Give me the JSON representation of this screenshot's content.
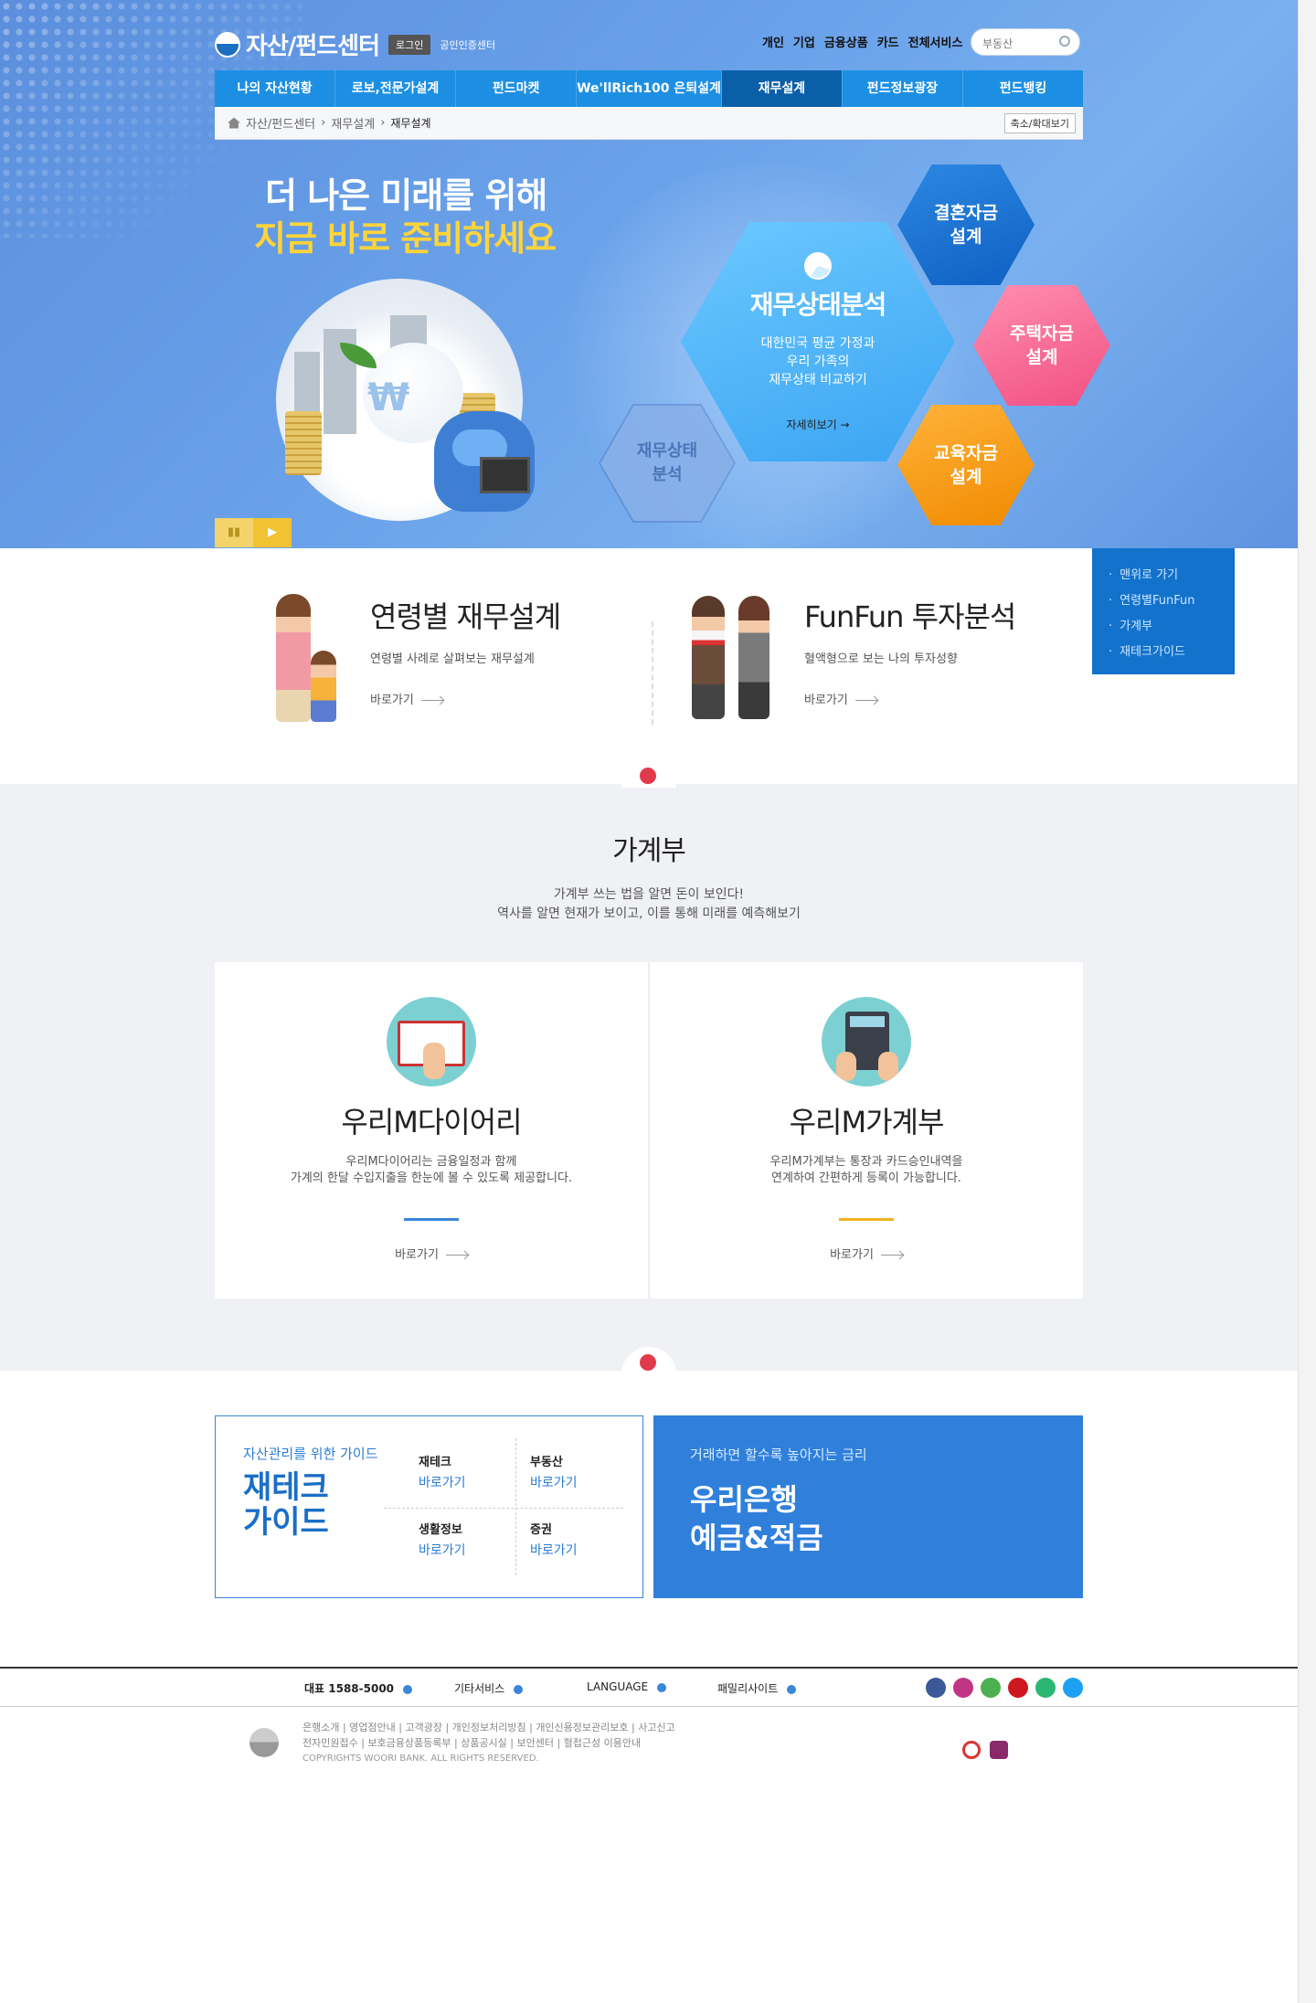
{
  "header": {
    "site_title": "자산/펀드센터",
    "login_label": "로그인",
    "cert_label": "공인인증센터",
    "top_links": [
      "개인",
      "기업",
      "금융상품",
      "카드",
      "전체서비스"
    ],
    "search_placeholder": "부동산"
  },
  "gnb": {
    "items": [
      "나의 자산현황",
      "로보,전문가설계",
      "펀드마켓",
      "We'llRich100 은퇴설계",
      "재무설계",
      "펀드정보광장",
      "펀드뱅킹"
    ],
    "active": "재무설계"
  },
  "breadcrumb": {
    "items": [
      "자산/펀드센터",
      "재무설계",
      "재무설계"
    ],
    "zoom_label": "축소/확대보기"
  },
  "hero": {
    "headline_1": "더 나은 미래를 위해",
    "headline_2": "지금 바로 준비하세요",
    "main_title": "재무상태분석",
    "main_desc_1": "대한민국 평균 가정과",
    "main_desc_2": "우리 가족의",
    "main_desc_3": "재무상태 비교하기",
    "main_more": "자세히보기 →",
    "wedding": "결혼자금 설계",
    "house": "주택자금 설계",
    "education": "교육자금 설계",
    "ghost": "재무상태 분석",
    "pause_icon": "pause-icon",
    "play_icon": "play-icon"
  },
  "quick_menu": {
    "items": [
      "맨위로 가기",
      "연령별FunFun",
      "가계부",
      "재테크가이드"
    ]
  },
  "features": [
    {
      "title": "연령별 재무설계",
      "desc": "연령별 사례로 살펴보는 재무설계",
      "link": "바로가기"
    },
    {
      "title": "FunFun 투자분석",
      "desc": "혈액형으로 보는 나의 투자성향",
      "link": "바로가기"
    }
  ],
  "budget": {
    "title": "가계부",
    "desc_1": "가계부 쓰는 법을 알면 돈이 보인다!",
    "desc_2": "역사를 알면 현재가 보이고, 이를 통해 미래를 예측해보기",
    "cards": [
      {
        "title": "우리M다이어리",
        "desc_1": "우리M다이어리는 금융일정과 함께",
        "desc_2": "가계의 한달 수입지출을 한눈에 볼 수 있도록 제공합니다.",
        "link": "바로가기",
        "accent": "#3a86d8"
      },
      {
        "title": "우리M가계부",
        "desc_1": "우리M가계부는 통장과 카드승인내역을",
        "desc_2": "연계하여 간편하게 등록이 가능합니다.",
        "link": "바로가기",
        "accent": "#f0b020"
      }
    ]
  },
  "guide": {
    "sub": "자산관리를 위한 가이드",
    "title_1": "재테크",
    "title_2": "가이드",
    "cells": [
      {
        "name": "재테크",
        "link": "바로가기"
      },
      {
        "name": "부동산",
        "link": "바로가기"
      },
      {
        "name": "생활정보",
        "link": "바로가기"
      },
      {
        "name": "증권",
        "link": "바로가기"
      }
    ]
  },
  "savings": {
    "sub": "거래하면 할수록 높아지는 금리",
    "title_1": "우리은행",
    "title_2": "예금&적금"
  },
  "footer": {
    "nav": [
      "대표 1588-5000",
      "기타서비스",
      "LANGUAGE",
      "패밀리사이트"
    ],
    "links_1": "은행소개 | 영업점안내 | 고객광장 | 개인정보처리방침 | 개인신용정보관리보호 | 사고신고",
    "links_2": "전자민원접수 | 보호금융상품등록부 | 상품공시실 | 보안센터 | 혈접근성 이용안내",
    "copyright": "COPYRIGHTS WOORI BANK. ALL RIGHTS RESERVED.",
    "sns": [
      "facebook-icon",
      "instagram-icon",
      "kakao-icon",
      "youtube-icon",
      "play-icon",
      "twitter-icon"
    ],
    "colors": {
      "facebook": "#3b5998",
      "instagram": "#c13584",
      "kakao": "#4caf50",
      "youtube": "#cc181e",
      "play": "#2bb673",
      "twitter": "#1da1f2"
    }
  }
}
